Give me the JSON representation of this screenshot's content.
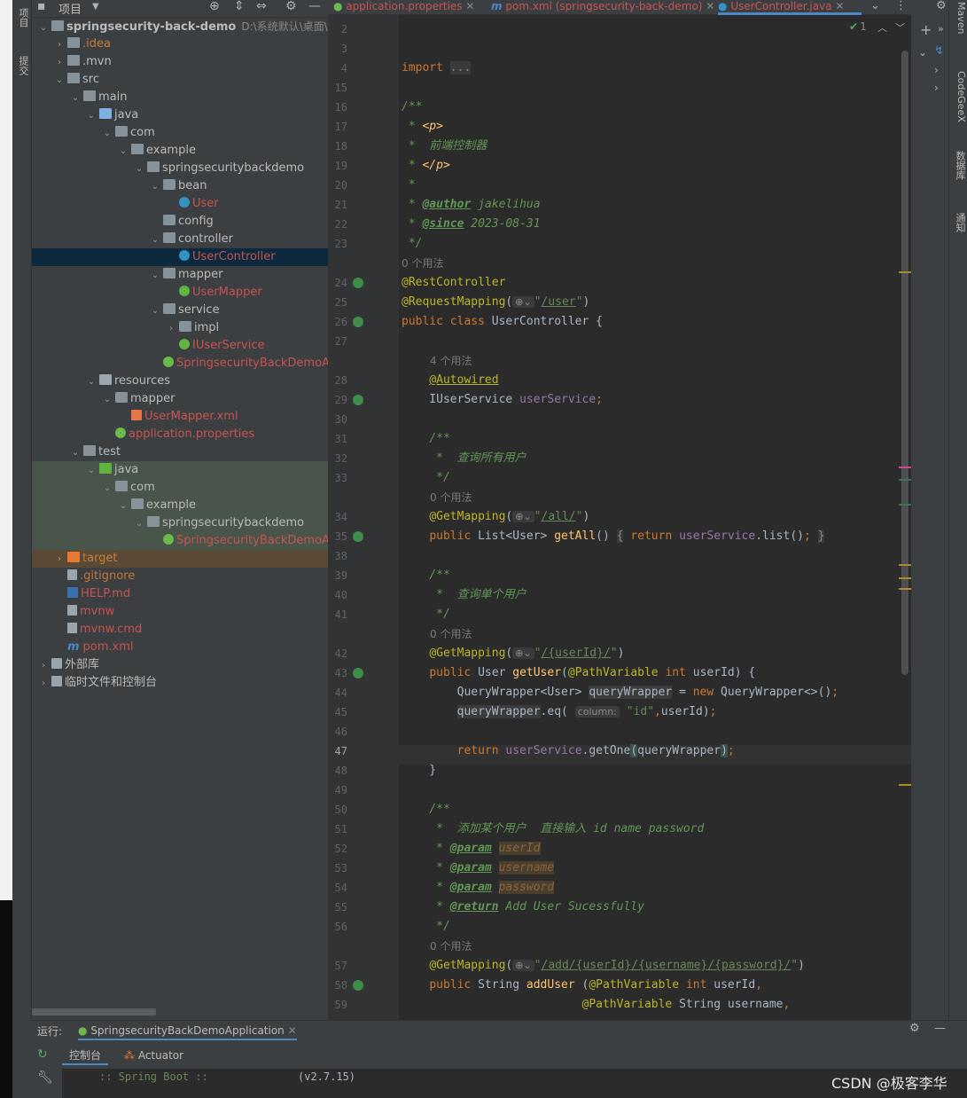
{
  "left_stripe": {
    "project_tab": "项目",
    "commit_tab": "提交"
  },
  "project_panel": {
    "title": "项目",
    "tree": [
      {
        "label": "springsecurity-back-demo",
        "extra": "D:\\系统默认\\桌面\\博客",
        "indent": 0,
        "arrow": "down",
        "icon": "folder",
        "style": "bold"
      },
      {
        "label": ".idea",
        "indent": 1,
        "arrow": "right",
        "icon": "folder",
        "style": "orange"
      },
      {
        "label": ".mvn",
        "indent": 1,
        "arrow": "right",
        "icon": "folder",
        "style": ""
      },
      {
        "label": "src",
        "indent": 1,
        "arrow": "down",
        "icon": "folder",
        "style": ""
      },
      {
        "label": "main",
        "indent": 2,
        "arrow": "down",
        "icon": "folder",
        "style": ""
      },
      {
        "label": "java",
        "indent": 3,
        "arrow": "down",
        "icon": "folder-src",
        "style": ""
      },
      {
        "label": "com",
        "indent": 4,
        "arrow": "down",
        "icon": "folder",
        "style": ""
      },
      {
        "label": "example",
        "indent": 5,
        "arrow": "down",
        "icon": "folder",
        "style": ""
      },
      {
        "label": "springsecuritybackdemo",
        "indent": 6,
        "arrow": "down",
        "icon": "folder",
        "style": ""
      },
      {
        "label": "bean",
        "indent": 7,
        "arrow": "down",
        "icon": "folder",
        "style": ""
      },
      {
        "label": "User",
        "indent": 8,
        "arrow": "",
        "icon": "class",
        "style": "red"
      },
      {
        "label": "config",
        "indent": 7,
        "arrow": "",
        "icon": "folder",
        "style": ""
      },
      {
        "label": "controller",
        "indent": 7,
        "arrow": "down",
        "icon": "folder",
        "style": ""
      },
      {
        "label": "UserController",
        "indent": 8,
        "arrow": "",
        "icon": "class",
        "style": "red",
        "selected": true
      },
      {
        "label": "mapper",
        "indent": 7,
        "arrow": "down",
        "icon": "folder",
        "style": ""
      },
      {
        "label": "UserMapper",
        "indent": 8,
        "arrow": "",
        "icon": "iface",
        "style": "red"
      },
      {
        "label": "service",
        "indent": 7,
        "arrow": "down",
        "icon": "folder",
        "style": ""
      },
      {
        "label": "impl",
        "indent": 8,
        "arrow": "right",
        "icon": "folder",
        "style": ""
      },
      {
        "label": "IUserService",
        "indent": 8,
        "arrow": "",
        "icon": "iface",
        "style": "red"
      },
      {
        "label": "SpringsecurityBackDemoApplication",
        "indent": 7,
        "arrow": "",
        "icon": "spring",
        "style": "red"
      },
      {
        "label": "resources",
        "indent": 3,
        "arrow": "down",
        "icon": "folder-res",
        "style": ""
      },
      {
        "label": "mapper",
        "indent": 4,
        "arrow": "down",
        "icon": "folder",
        "style": ""
      },
      {
        "label": "UserMapper.xml",
        "indent": 5,
        "arrow": "",
        "icon": "xml",
        "style": "red"
      },
      {
        "label": "application.properties",
        "indent": 4,
        "arrow": "",
        "icon": "spring",
        "style": "red"
      },
      {
        "label": "test",
        "indent": 2,
        "arrow": "down",
        "icon": "folder",
        "style": ""
      },
      {
        "label": "java",
        "indent": 3,
        "arrow": "down",
        "icon": "folder-test",
        "style": "",
        "test": true
      },
      {
        "label": "com",
        "indent": 4,
        "arrow": "down",
        "icon": "folder",
        "style": "",
        "test": true
      },
      {
        "label": "example",
        "indent": 5,
        "arrow": "down",
        "icon": "folder",
        "style": "",
        "test": true
      },
      {
        "label": "springsecuritybackdemo",
        "indent": 6,
        "arrow": "down",
        "icon": "folder",
        "style": "",
        "test": true
      },
      {
        "label": "SpringsecurityBackDemoApplication",
        "indent": 7,
        "arrow": "",
        "icon": "spring",
        "style": "red",
        "test": true
      },
      {
        "label": "target",
        "indent": 1,
        "arrow": "right",
        "icon": "folder-tgt",
        "style": "orange",
        "target": true
      },
      {
        "label": ".gitignore",
        "indent": 1,
        "arrow": "",
        "icon": "file",
        "style": "red"
      },
      {
        "label": "HELP.md",
        "indent": 1,
        "arrow": "",
        "icon": "md",
        "style": "red"
      },
      {
        "label": "mvnw",
        "indent": 1,
        "arrow": "",
        "icon": "file",
        "style": "red"
      },
      {
        "label": "mvnw.cmd",
        "indent": 1,
        "arrow": "",
        "icon": "file",
        "style": "red"
      },
      {
        "label": "pom.xml",
        "indent": 1,
        "arrow": "",
        "icon": "maven",
        "style": "red"
      },
      {
        "label": "外部库",
        "indent": 0,
        "arrow": "right",
        "icon": "lib",
        "style": ""
      },
      {
        "label": "临时文件和控制台",
        "indent": 0,
        "arrow": "right",
        "icon": "scratch",
        "style": ""
      }
    ]
  },
  "tabs": [
    {
      "label": "application.properties",
      "active": false
    },
    {
      "label": "pom.xml (springsecurity-back-demo)",
      "active": false
    },
    {
      "label": "UserController.java",
      "active": true
    }
  ],
  "editor": {
    "inspection": "1",
    "usages_0": "0 个用法",
    "usages_4": "4 个用法",
    "column_hint": "column:",
    "current_line": "47"
  },
  "right_stripe": {
    "maven": "Maven",
    "codegeex": "CodeGeeX",
    "database": "数据库",
    "notifications": "通知"
  },
  "run_panel": {
    "label": "运行:",
    "config": "SpringsecurityBackDemoApplication",
    "console_tab": "控制台",
    "actuator_tab": "Actuator",
    "output_left": ":: Spring Boot ::",
    "output_right": "(v2.7.15)"
  },
  "watermark": "CSDN @极客李华",
  "colors": {
    "keyword": "#cc7832",
    "annotation": "#bbb529",
    "string": "#6a8759",
    "field": "#9876aa",
    "method": "#ffc66d",
    "selection": "#0d293e"
  }
}
